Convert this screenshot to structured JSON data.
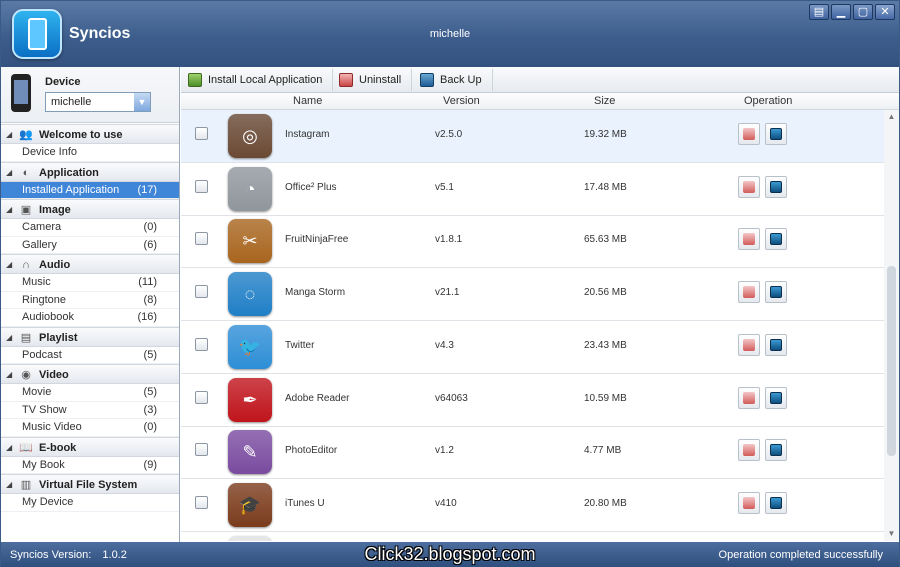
{
  "window": {
    "app_name": "Syncios",
    "user": "michelle",
    "controls": [
      "▤",
      "▁",
      "▢",
      "✕"
    ]
  },
  "device": {
    "label": "Device",
    "selected": "michelle"
  },
  "sidebar": {
    "categories": [
      {
        "label": "Welcome to use",
        "icon": "users-icon",
        "items": [
          {
            "label": "Device Info",
            "count": ""
          }
        ]
      },
      {
        "label": "Application",
        "icon": "app-icon",
        "items": [
          {
            "label": "Installed Application",
            "count": "(17)",
            "selected": true
          }
        ]
      },
      {
        "label": "Image",
        "icon": "image-icon",
        "items": [
          {
            "label": "Camera",
            "count": "(0)"
          },
          {
            "label": "Gallery",
            "count": "(6)"
          }
        ]
      },
      {
        "label": "Audio",
        "icon": "headphones-icon",
        "items": [
          {
            "label": "Music",
            "count": "(11)"
          },
          {
            "label": "Ringtone",
            "count": "(8)"
          },
          {
            "label": "Audiobook",
            "count": "(16)"
          }
        ]
      },
      {
        "label": "Playlist",
        "icon": "playlist-icon",
        "items": [
          {
            "label": "Podcast",
            "count": "(5)"
          }
        ]
      },
      {
        "label": "Video",
        "icon": "video-icon",
        "items": [
          {
            "label": "Movie",
            "count": "(5)"
          },
          {
            "label": "TV Show",
            "count": "(3)"
          },
          {
            "label": "Music Video",
            "count": "(0)"
          }
        ]
      },
      {
        "label": "E-book",
        "icon": "book-icon",
        "items": [
          {
            "label": "My Book",
            "count": "(9)"
          }
        ]
      },
      {
        "label": "Virtual File System",
        "icon": "file-system-icon",
        "items": [
          {
            "label": "My Device",
            "count": ""
          }
        ]
      }
    ]
  },
  "toolbar": {
    "install_label": "Install Local Application",
    "uninstall_label": "Uninstall",
    "backup_label": "Back Up"
  },
  "table": {
    "columns": {
      "name": "Name",
      "version": "Version",
      "size": "Size",
      "operation": "Operation"
    },
    "rows": [
      {
        "name": "Instagram",
        "version": "v2.5.0",
        "size": "19.32 MB",
        "icon_color": "#6b4a34",
        "highlighted": true
      },
      {
        "name": "Office² Plus",
        "version": "v5.1",
        "size": "17.48 MB",
        "icon_color": "#8f969c"
      },
      {
        "name": "FruitNinjaFree",
        "version": "v1.8.1",
        "size": "65.63 MB",
        "icon_color": "#a8651e"
      },
      {
        "name": "Manga Storm",
        "version": "v21.1",
        "size": "20.56 MB",
        "icon_color": "#1f7fc6"
      },
      {
        "name": "Twitter",
        "version": "v4.3",
        "size": "23.43 MB",
        "icon_color": "#2d8ed6"
      },
      {
        "name": "Adobe Reader",
        "version": "v64063",
        "size": "10.59 MB",
        "icon_color": "#c0141c"
      },
      {
        "name": "PhotoEditor",
        "version": "v1.2",
        "size": "4.77 MB",
        "icon_color": "#7a4ba0"
      },
      {
        "name": "iTunes U",
        "version": "v410",
        "size": "20.80 MB",
        "icon_color": "#7b3b1c"
      }
    ]
  },
  "status": {
    "version_label": "Syncios Version:",
    "version": "1.0.2",
    "watermark": "Click32.blogspot.com",
    "message": "Operation completed successfully"
  }
}
